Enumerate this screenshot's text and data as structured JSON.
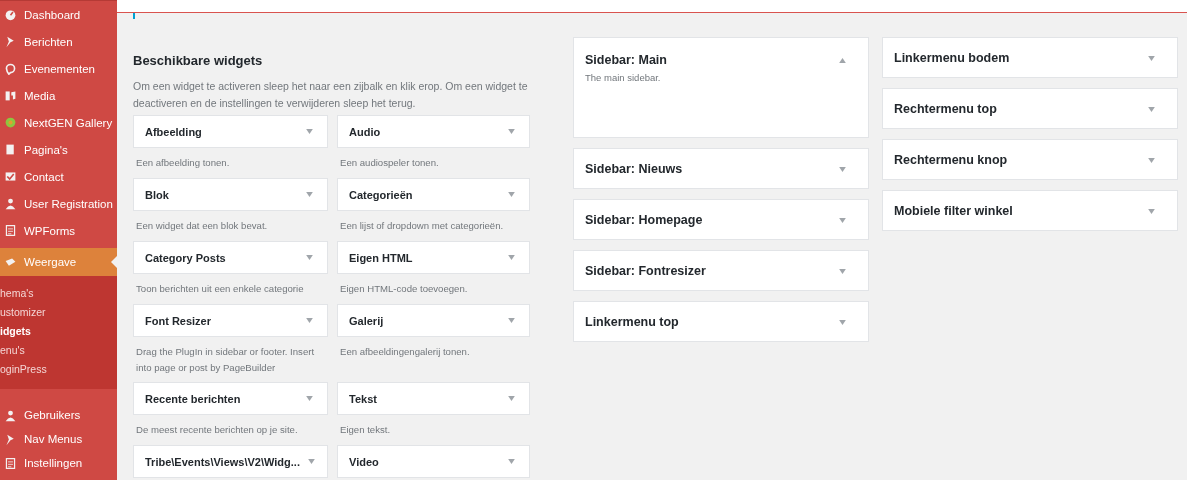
{
  "admin_menu": {
    "items": [
      {
        "label": "Dashboard",
        "selected": false
      },
      {
        "label": "Berichten",
        "selected": false
      },
      {
        "label": "Evenementen",
        "selected": false
      },
      {
        "label": "Media",
        "selected": false
      },
      {
        "label": "NextGEN Gallery",
        "selected": false
      },
      {
        "label": "Pagina's",
        "selected": false
      },
      {
        "label": "Contact",
        "selected": false
      },
      {
        "label": "User Registration",
        "selected": false
      },
      {
        "label": "WPForms",
        "selected": false
      },
      {
        "label": "Weergave",
        "selected": true,
        "children": [
          {
            "label": "hema's",
            "selected": false
          },
          {
            "label": "ustomizer",
            "selected": false
          },
          {
            "label": "idgets",
            "selected": true
          },
          {
            "label": "enu's",
            "selected": false
          },
          {
            "label": "oginPress",
            "selected": false
          }
        ]
      },
      {
        "label": "Gebruikers",
        "selected": false
      },
      {
        "label": "Nav Menus",
        "selected": false
      },
      {
        "label": "Instellingen",
        "selected": false
      }
    ]
  },
  "available_widgets": {
    "title": "Beschikbare widgets",
    "description": "Om een widget te activeren sleep het naar een zijbalk en klik erop. Om een widget te deactiveren en de instellingen te verwijderen sleep het terug.",
    "widgets": [
      {
        "name": "Afbeelding",
        "description": "Een afbeelding tonen."
      },
      {
        "name": "Audio",
        "description": "Een audiospeler tonen."
      },
      {
        "name": "Blok",
        "description": "Een widget dat een blok bevat."
      },
      {
        "name": "Categorieën",
        "description": "Een lijst of dropdown met categorieën."
      },
      {
        "name": "Category Posts",
        "description": "Toon berichten uit een enkele categorie"
      },
      {
        "name": "Eigen HTML",
        "description": "Eigen HTML-code toevoegen."
      },
      {
        "name": "Font Resizer",
        "description": "Drag the PlugIn in sidebar or footer. Insert into page or post by PageBuilder"
      },
      {
        "name": "Galerij",
        "description": "Een afbeeldingengalerij tonen."
      },
      {
        "name": "Recente berichten",
        "description": "De meest recente berichten op je site."
      },
      {
        "name": "Tekst",
        "description": "Eigen tekst."
      },
      {
        "name": "Tribe\\Events\\Views\\V2\\Widg..."
      },
      {
        "name": "Video"
      }
    ]
  },
  "widget_areas": [
    [
      {
        "title": "Sidebar: Main",
        "expanded": true,
        "description": "The main sidebar."
      },
      {
        "title": "Sidebar: Nieuws",
        "expanded": false
      },
      {
        "title": "Sidebar: Homepage",
        "expanded": false
      },
      {
        "title": "Sidebar: Fontresizer",
        "expanded": false
      },
      {
        "title": "Linkermenu top",
        "expanded": false
      }
    ],
    [
      {
        "title": "Linkermenu bodem",
        "expanded": false
      },
      {
        "title": "Rechtermenu top",
        "expanded": false
      },
      {
        "title": "Rechtermenu knop",
        "expanded": false
      },
      {
        "title": "Mobiele filter winkel",
        "expanded": false
      }
    ]
  ]
}
